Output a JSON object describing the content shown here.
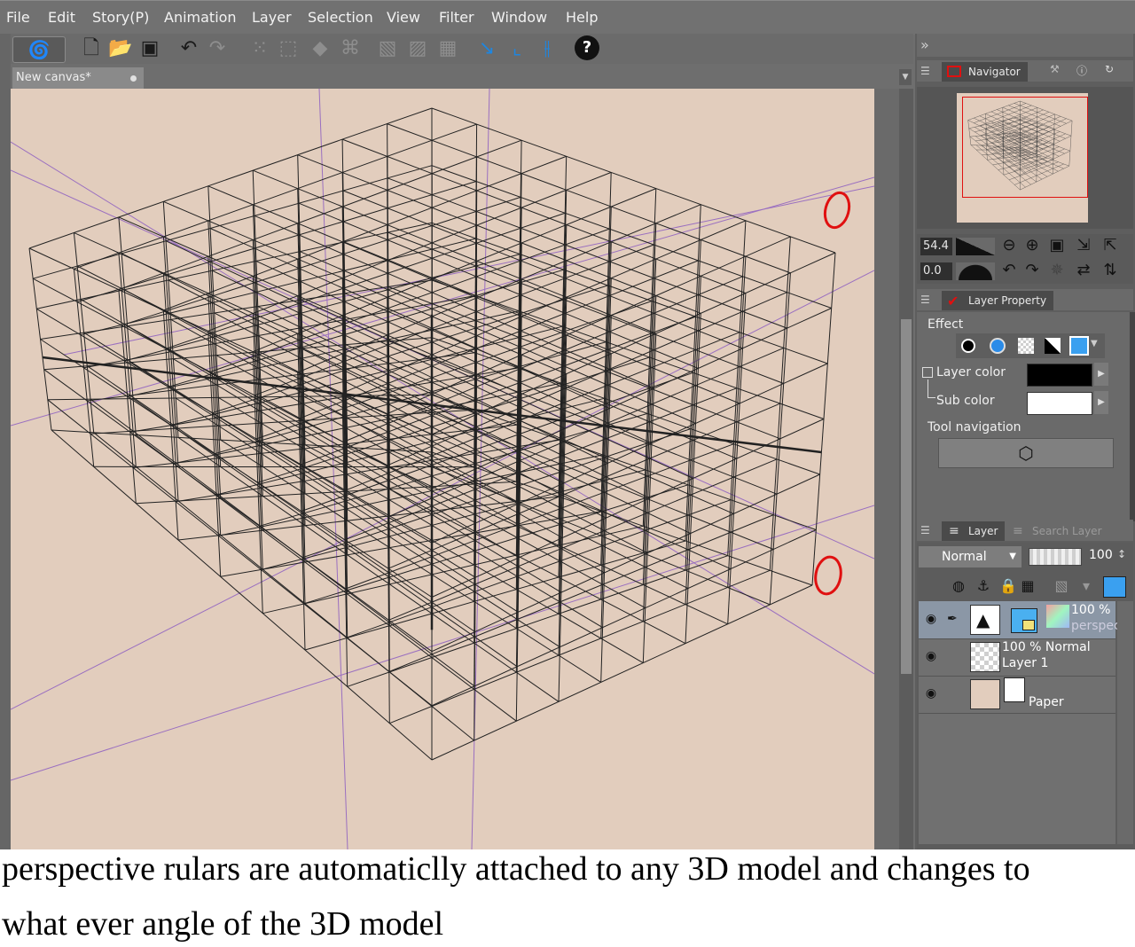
{
  "menu": [
    "File",
    "Edit",
    "Story(P)",
    "Animation",
    "Layer",
    "Selection",
    "View",
    "Filter",
    "Window",
    "Help"
  ],
  "toolbar": {
    "icons": [
      "new-file-icon",
      "open-folder-icon",
      "save-icon",
      "undo-icon",
      "redo-icon",
      "selection-icon",
      "transform-icon",
      "fill-icon",
      "crop-icon",
      "ruler-a-icon",
      "ruler-b-icon",
      "ruler-c-icon",
      "ruler-d-icon",
      "ruler-e-icon",
      "ruler-f-icon"
    ],
    "help_label": "?"
  },
  "canvas_tab": {
    "title": "New canvas*"
  },
  "navigator": {
    "tabs": [
      "Navigator"
    ],
    "zoom": "54.4",
    "rotation": "0.0"
  },
  "layer_property": {
    "title": "Layer Property",
    "effect_label": "Effect",
    "layer_color_label": "Layer color",
    "layer_color": "#000000",
    "sub_color_label": "Sub color",
    "sub_color": "#ffffff",
    "tool_navigation_label": "Tool navigation"
  },
  "layer_panel": {
    "tabs": [
      "Layer",
      "Search Layer"
    ],
    "blend_mode": "Normal",
    "opacity": "100",
    "layers": [
      {
        "opacity": "100 %",
        "name": "perspect",
        "type": "3d"
      },
      {
        "mode": "100 % Normal",
        "name": "Layer 1",
        "type": "raster"
      },
      {
        "name": "Paper",
        "type": "paper"
      }
    ]
  },
  "caption": {
    "line1": "perspective rulars are automaticlly attached to any 3D model and changes to",
    "line2": "what ever angle of the 3D model"
  },
  "colors": {
    "canvas_bg": "#e2cdbd",
    "annotation": "#e01010",
    "ruler_line": "#9a6fc0"
  }
}
